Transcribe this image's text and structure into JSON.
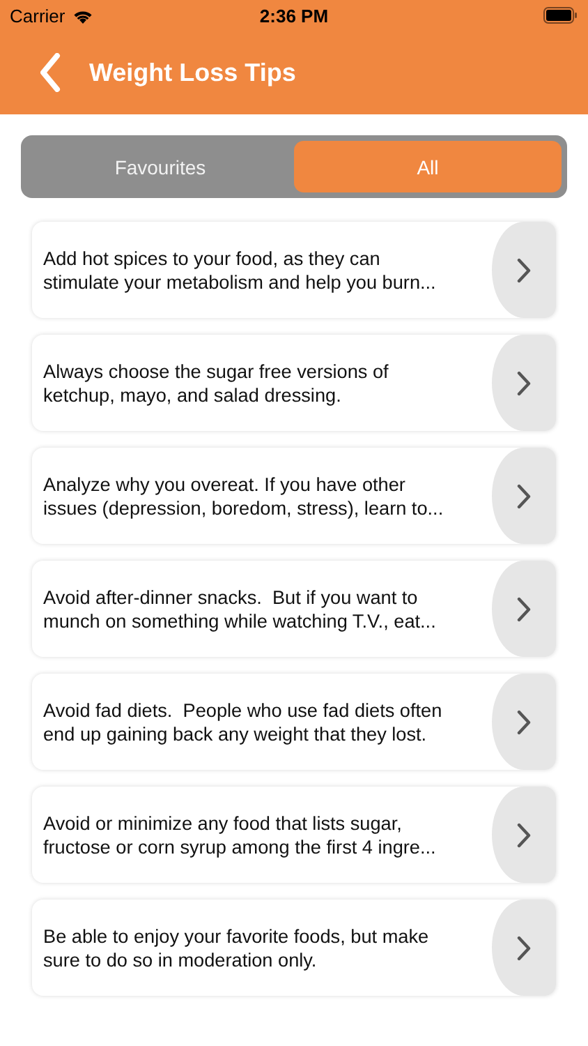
{
  "status_bar": {
    "carrier": "Carrier",
    "time": "2:36 PM"
  },
  "header": {
    "title": "Weight Loss Tips"
  },
  "segments": [
    {
      "label": "Favourites",
      "selected": false
    },
    {
      "label": "All",
      "selected": true
    }
  ],
  "tips": [
    {
      "lines": [
        "Add hot spices to your food, as they can",
        "stimulate your metabolism and help you burn..."
      ]
    },
    {
      "lines": [
        "Always choose the sugar free versions of",
        "ketchup, mayo, and salad dressing."
      ]
    },
    {
      "lines": [
        "Analyze why you overeat. If you have other",
        "issues (depression, boredom, stress), learn to..."
      ]
    },
    {
      "lines": [
        "Avoid after-dinner snacks.  But if you want to",
        "munch on something while watching T.V., eat..."
      ]
    },
    {
      "lines": [
        "Avoid fad diets.  People who use fad diets often",
        "end up gaining back any weight that they lost."
      ]
    },
    {
      "lines": [
        "Avoid or minimize any food that lists sugar,",
        "fructose or corn syrup among the first 4 ingre..."
      ]
    },
    {
      "lines": [
        "Be able to enjoy your favorite foods, but make",
        "sure to do so in moderation only."
      ]
    }
  ]
}
